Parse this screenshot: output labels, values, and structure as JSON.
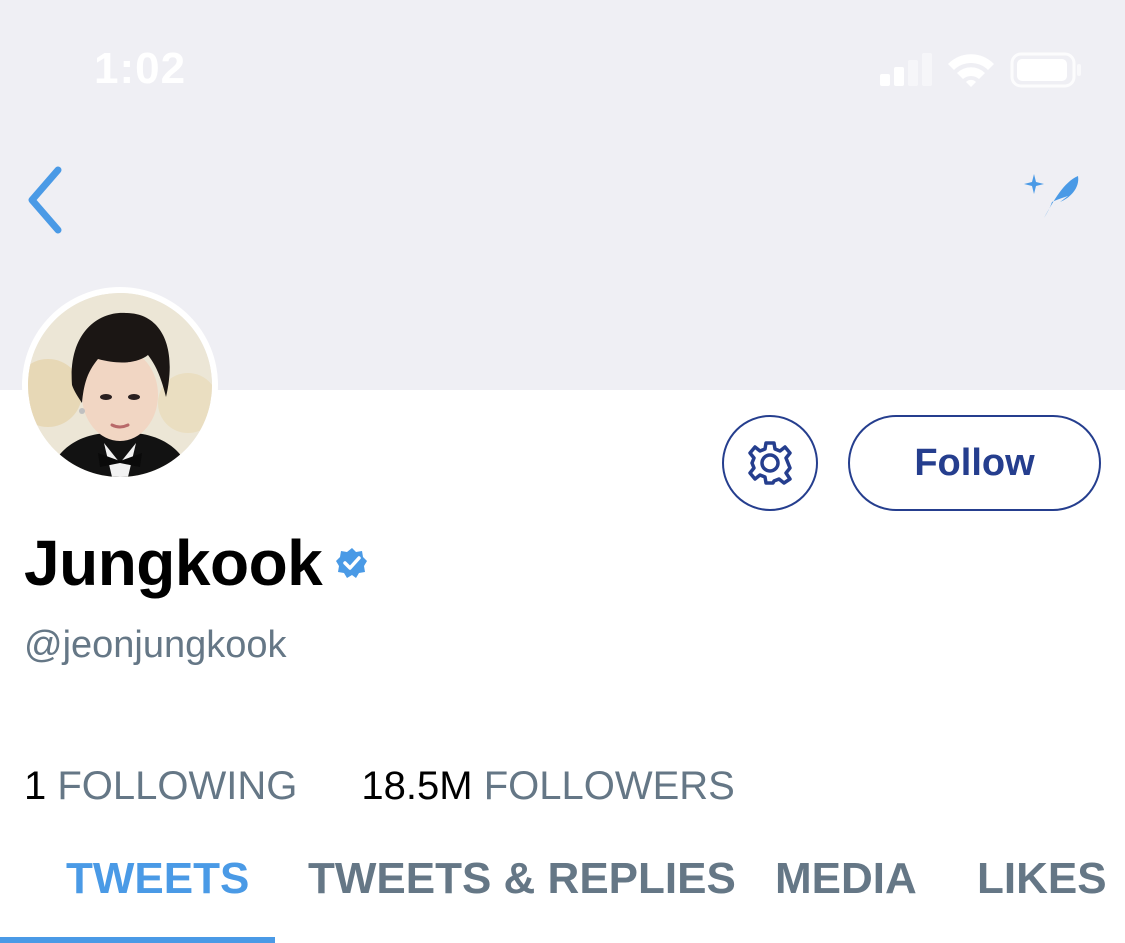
{
  "status_bar": {
    "time": "1:02"
  },
  "colors": {
    "header_bg": "#efeff4",
    "accent_blue": "#4a9ae6",
    "button_navy": "#253e8e",
    "secondary_text": "#657786"
  },
  "nav": {
    "back_icon": "chevron-left-icon",
    "compose_icon": "sparkle-feather-icon"
  },
  "profile": {
    "display_name": "Jungkook",
    "handle": "@jeonjungkook",
    "verified": true,
    "follow_label": "Follow",
    "settings_icon": "gear-icon"
  },
  "stats": {
    "following_count": "1",
    "following_label": "FOLLOWING",
    "followers_count": "18.5M",
    "followers_label": "FOLLOWERS"
  },
  "tabs": [
    {
      "label": "TWEETS",
      "active": true
    },
    {
      "label": "TWEETS & REPLIES",
      "active": false
    },
    {
      "label": "MEDIA",
      "active": false
    },
    {
      "label": "LIKES",
      "active": false
    }
  ]
}
